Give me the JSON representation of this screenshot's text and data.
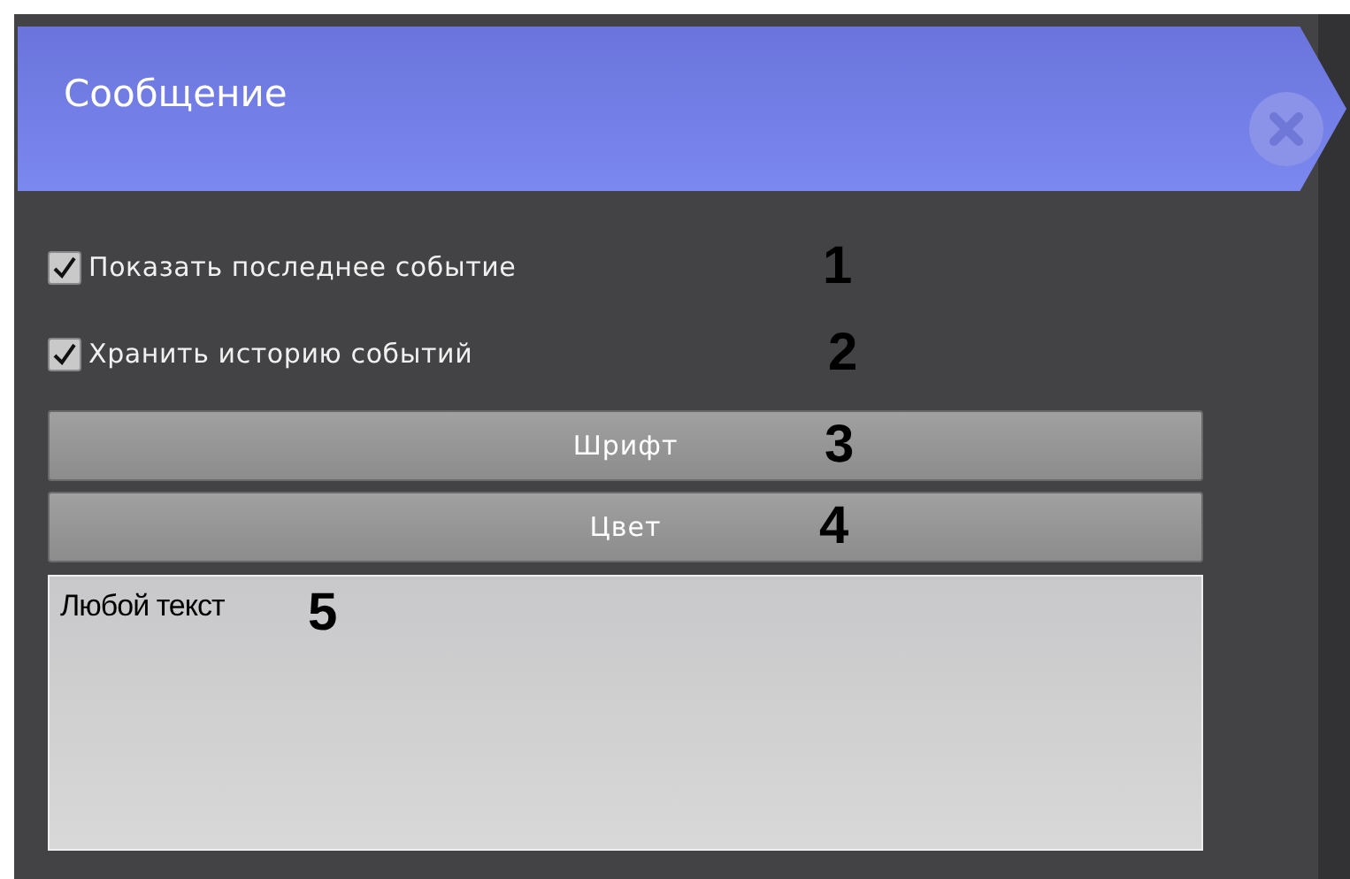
{
  "header": {
    "title": "Сообщение"
  },
  "options": [
    {
      "label": "Показать последнее событие",
      "checked": true,
      "annotation": "1"
    },
    {
      "label": "Хранить историю событий",
      "checked": true,
      "annotation": "2"
    }
  ],
  "buttons": [
    {
      "label": "Шрифт",
      "annotation": "3"
    },
    {
      "label": "Цвет",
      "annotation": "4"
    }
  ],
  "text_field": {
    "value": "Любой текст",
    "annotation": "5"
  }
}
